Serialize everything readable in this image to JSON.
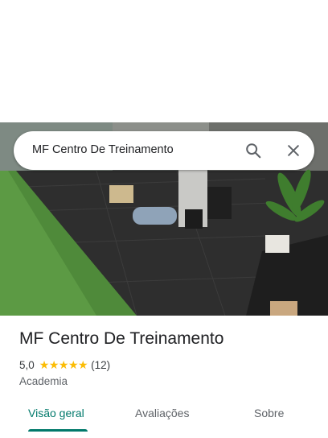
{
  "search": {
    "query": "MF Centro De Treinamento"
  },
  "icons": {
    "search": "search-icon",
    "close": "close-icon",
    "star": "star-icon"
  },
  "place": {
    "name": "MF Centro De Treinamento",
    "rating": "5,0",
    "stars": 5,
    "review_count": "(12)",
    "category": "Academia"
  },
  "tabs": [
    {
      "label": "Visão geral",
      "active": true
    },
    {
      "label": "Avaliações",
      "active": false
    },
    {
      "label": "Sobre",
      "active": false
    }
  ],
  "colors": {
    "accent": "#00796b",
    "star": "#fbbc04",
    "text": "#202124",
    "secondary": "#5f6368"
  }
}
